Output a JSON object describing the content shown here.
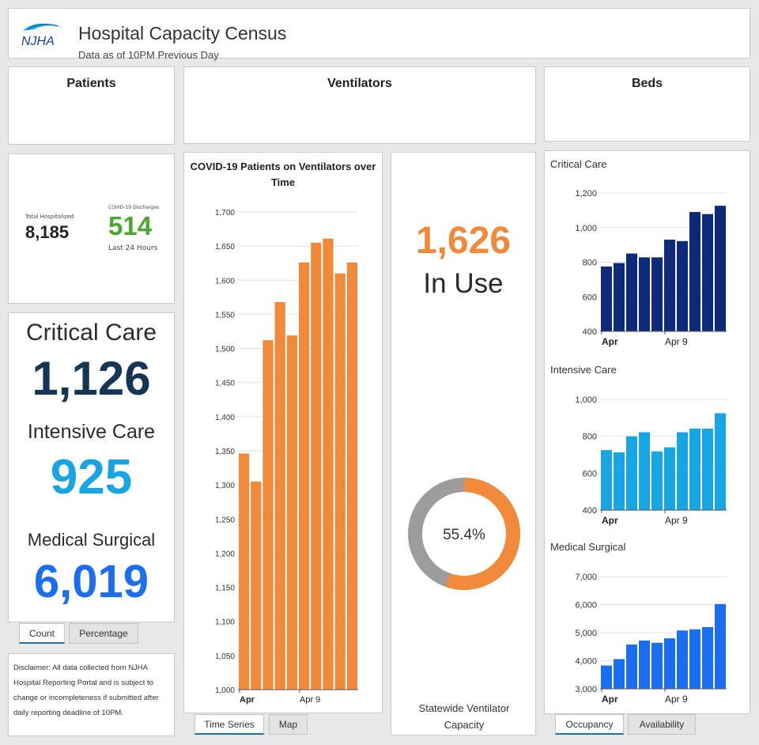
{
  "header": {
    "logo_text": "NJHA",
    "title": "Hospital Capacity Census",
    "subtitle": "Data as of 10PM Previous Day"
  },
  "sections": {
    "patients": "Patients",
    "ventilators": "Ventilators",
    "beds": "Beds"
  },
  "patients_summary": {
    "total_label": "Total Hospitalized",
    "total_value": "8,185",
    "discharges_label": "COVID-19 Discharges",
    "discharges_value": "514",
    "discharges_sub": "Last 24 Hours"
  },
  "bed_counts": {
    "critical_label": "Critical Care",
    "critical_value": "1,126",
    "intensive_label": "Intensive Care",
    "intensive_value": "925",
    "medsurg_label": "Medical Surgical",
    "medsurg_value": "6,019",
    "tabs": [
      "Count",
      "Percentage"
    ]
  },
  "disclaimer": "Disclaimer:  All data collected from NJHA Hospital Reporting Portal and is subject to change or incompleteness if submitted after daily reporting deadline of 10PM.",
  "ventilators": {
    "in_use_value": "1,626",
    "in_use_label": "In Use",
    "capacity_percent": 55.4,
    "capacity_percent_text": "55.4%",
    "capacity_label": "Statewide Ventilator Capacity",
    "tabs": [
      "Time Series",
      "Map"
    ]
  },
  "beds_tabs": [
    "Occupancy",
    "Availability"
  ],
  "colors": {
    "orange": "#f0893a",
    "gray": "#9c9c9c",
    "navy": "#0c2a78",
    "sky": "#17a5e3",
    "blue": "#1c6ef0",
    "green": "#4aa82a",
    "dark": "#153456"
  },
  "chart_data": [
    {
      "type": "bar",
      "title": "COVID-19 Patients on Ventilators over Time",
      "x_tick_labels": [
        "Apr",
        "Apr 9"
      ],
      "values": [
        1346,
        1305,
        1512,
        1568,
        1519,
        1626,
        1655,
        1661,
        1610,
        1626
      ],
      "ylim": [
        1000,
        1700
      ],
      "y_ticks": [
        "1,000",
        "1,050",
        "1,100",
        "1,150",
        "1,200",
        "1,250",
        "1,300",
        "1,350",
        "1,400",
        "1,450",
        "1,500",
        "1,550",
        "1,600",
        "1,650",
        "1,700"
      ],
      "grid": true
    },
    {
      "type": "bar",
      "title": "Critical Care",
      "x_tick_labels": [
        "Apr",
        "Apr 9"
      ],
      "values": [
        775,
        795,
        850,
        828,
        828,
        930,
        922,
        1090,
        1078,
        1126
      ],
      "ylim": [
        400,
        1200
      ],
      "y_ticks": [
        "400",
        "600",
        "800",
        "1,000",
        "1,200"
      ],
      "grid": true
    },
    {
      "type": "bar",
      "title": "Intensive Care",
      "x_tick_labels": [
        "Apr",
        "Apr 9"
      ],
      "values": [
        725,
        713,
        800,
        822,
        718,
        740,
        822,
        842,
        842,
        925
      ],
      "ylim": [
        400,
        1000
      ],
      "y_ticks": [
        "400",
        "600",
        "800",
        "1,000"
      ],
      "grid": true
    },
    {
      "type": "bar",
      "title": "Medical Surgical",
      "x_tick_labels": [
        "Apr",
        "Apr 9"
      ],
      "values": [
        3830,
        4060,
        4580,
        4720,
        4640,
        4800,
        5080,
        5120,
        5200,
        6019
      ],
      "ylim": [
        3000,
        7000
      ],
      "y_ticks": [
        "3,000",
        "4,000",
        "5,000",
        "6,000",
        "7,000"
      ],
      "grid": true
    }
  ]
}
